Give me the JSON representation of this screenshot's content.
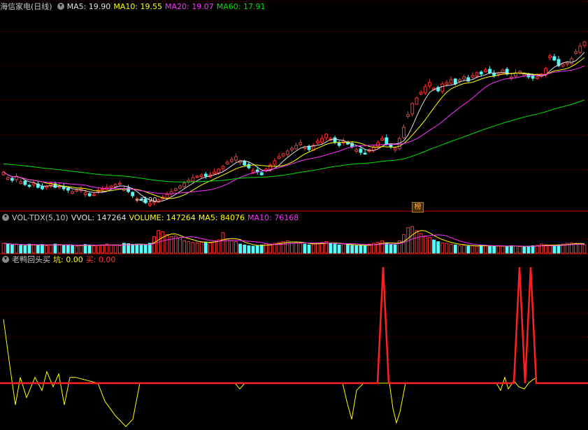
{
  "colors": {
    "up": "#ff3232",
    "down": "#54fcfc",
    "ma5": "#e0e0e0",
    "ma10": "#ffff00",
    "ma20": "#ff30ff",
    "ma60": "#00e000",
    "grid": "#7a0000",
    "sep": "#8a0000"
  },
  "price_panel": {
    "title": "海信家电",
    "period": "(日线)",
    "ma5_label": "MA5: 19.90",
    "ma10_label": "MA10: 19.55",
    "ma20_label": "MA20: 19.07",
    "ma60_label": "MA60: 17.91",
    "low_marker": "←9.90",
    "badge": "榜"
  },
  "volume_panel": {
    "title": "VOL-TDX(5,10)",
    "vvol_label": "VVOL: 147264",
    "volume_label": "VOLUME: 147264",
    "ma5_label": "MA5: 84076",
    "ma10_label": "MA10: 76168"
  },
  "indicator_panel": {
    "title": "老鸭回头买",
    "keng_label": "坑: 0.00",
    "mai_label": "买: 0.00"
  },
  "chart_data": [
    {
      "type": "candlestick",
      "name": "price",
      "close": [
        12.2,
        11.8,
        11.6,
        11.9,
        11.5,
        11.3,
        11.2,
        11.4,
        11.1,
        11.0,
        11.2,
        11.4,
        11.1,
        11.2,
        11.0,
        10.9,
        10.8,
        10.9,
        11.0,
        10.7,
        10.5,
        10.6,
        10.9,
        11.0,
        11.1,
        11.2,
        11.3,
        11.4,
        11.0,
        10.8,
        10.5,
        10.3,
        10.2,
        10.0,
        9.95,
        10.1,
        10.2,
        10.4,
        10.6,
        10.8,
        11.0,
        11.2,
        11.4,
        11.6,
        11.8,
        11.9,
        12.0,
        11.9,
        12.0,
        12.2,
        12.4,
        12.6,
        12.9,
        13.1,
        13.3,
        13.0,
        12.7,
        12.5,
        12.3,
        12.2,
        12.0,
        12.4,
        12.7,
        13.0,
        13.3,
        13.5,
        13.7,
        13.9,
        14.1,
        14.3,
        14.0,
        13.8,
        14.1,
        14.4,
        14.6,
        14.9,
        14.6,
        14.3,
        14.1,
        14.4,
        14.2,
        14.0,
        13.8,
        13.6,
        13.5,
        13.8,
        14.0,
        14.3,
        14.6,
        14.2,
        14.0,
        13.9,
        14.6,
        15.4,
        16.3,
        17.1,
        17.5,
        17.9,
        18.3,
        18.6,
        18.2,
        18.0,
        18.5,
        18.6,
        18.8,
        18.5,
        18.8,
        19.0,
        18.7,
        19.1,
        19.3,
        19.2,
        19.5,
        19.3,
        19.1,
        19.3,
        19.5,
        19.2,
        19.0,
        19.3,
        19.4,
        19.2,
        19.0,
        18.9,
        19.0,
        19.2,
        19.6,
        20.5,
        20.2,
        19.8,
        19.9,
        20.0,
        20.3,
        20.8,
        21.2,
        21.5
      ],
      "ylim": [
        9.5,
        23.5
      ]
    },
    {
      "type": "bar",
      "name": "volume",
      "series": [
        {
          "name": "VVOL",
          "values": [
            24,
            22,
            20,
            21,
            19,
            18,
            22,
            20,
            19,
            21,
            18,
            20,
            22,
            21,
            19,
            20,
            18,
            17,
            19,
            21,
            20,
            18,
            19,
            20,
            22,
            20,
            19,
            18,
            24,
            23,
            21,
            22,
            20,
            21,
            24,
            40,
            55,
            52,
            45,
            40,
            42,
            38,
            30,
            28,
            26,
            25,
            28,
            27,
            25,
            30,
            32,
            50,
            35,
            30,
            28,
            22,
            20,
            18,
            17,
            18,
            20,
            23,
            22,
            24,
            26,
            28,
            30,
            27,
            25,
            24,
            22,
            20,
            22,
            25,
            26,
            28,
            24,
            22,
            20,
            22,
            21,
            19,
            18,
            19,
            18,
            22,
            24,
            26,
            30,
            24,
            21,
            20,
            30,
            45,
            62,
            65,
            55,
            48,
            42,
            38,
            32,
            28,
            25,
            24,
            22,
            20,
            18,
            19,
            17,
            18,
            17,
            19,
            18,
            16,
            17,
            18,
            17,
            16,
            18,
            17,
            16,
            15,
            17,
            18,
            19,
            22,
            20,
            18,
            19,
            20,
            22,
            24,
            25,
            24,
            22,
            20
          ]
        },
        {
          "name": "VOLUME",
          "values": [
            24,
            22,
            20,
            21,
            19,
            18,
            22,
            20,
            19,
            21,
            18,
            20,
            22,
            21,
            19,
            20,
            18,
            17,
            19,
            21,
            20,
            18,
            19,
            20,
            22,
            20,
            19,
            18,
            24,
            23,
            21,
            22,
            20,
            21,
            24,
            40,
            55,
            52,
            45,
            40,
            42,
            38,
            30,
            28,
            26,
            25,
            28,
            27,
            25,
            30,
            32,
            50,
            35,
            30,
            28,
            22,
            20,
            18,
            17,
            18,
            20,
            23,
            22,
            24,
            26,
            28,
            30,
            27,
            25,
            24,
            22,
            20,
            22,
            25,
            26,
            28,
            24,
            22,
            20,
            22,
            21,
            19,
            18,
            19,
            18,
            22,
            24,
            26,
            30,
            24,
            21,
            20,
            30,
            45,
            62,
            65,
            55,
            48,
            42,
            38,
            32,
            28,
            25,
            24,
            22,
            20,
            18,
            19,
            17,
            18,
            17,
            19,
            18,
            16,
            17,
            18,
            17,
            16,
            18,
            17,
            16,
            15,
            17,
            18,
            19,
            22,
            20,
            18,
            19,
            20,
            22,
            24,
            25,
            24,
            22,
            20
          ]
        }
      ]
    },
    {
      "type": "line",
      "name": "indicator",
      "series": [
        {
          "name": "坑",
          "values": [
            [
              5,
              0.55
            ],
            [
              14,
              0.15
            ],
            [
              22,
              -0.3
            ],
            [
              29,
              0.05
            ],
            [
              38,
              -0.2
            ],
            [
              50,
              0.05
            ],
            [
              60,
              -0.1
            ],
            [
              67,
              0.1
            ],
            [
              76,
              -0.05
            ],
            [
              84,
              0.08
            ],
            [
              92,
              -0.3
            ],
            [
              100,
              0.05
            ],
            [
              108,
              0.05
            ],
            [
              140,
              0
            ],
            [
              150,
              -0.25
            ],
            [
              165,
              -0.45
            ],
            [
              180,
              -0.6
            ],
            [
              190,
              -0.5
            ],
            [
              200,
              0
            ],
            [
              336,
              0
            ],
            [
              343,
              -0.08
            ],
            [
              350,
              0
            ],
            [
              490,
              0
            ],
            [
              496,
              -0.25
            ],
            [
              503,
              -0.5
            ],
            [
              510,
              -0.1
            ],
            [
              520,
              0
            ],
            [
              557,
              0
            ],
            [
              562,
              -0.35
            ],
            [
              567,
              -0.55
            ],
            [
              572,
              -0.4
            ],
            [
              580,
              0
            ],
            [
              710,
              0
            ],
            [
              716,
              -0.1
            ],
            [
              722,
              0.05
            ],
            [
              727,
              -0.08
            ],
            [
              735,
              0.02
            ],
            [
              742,
              -0.05
            ],
            [
              750,
              -0.08
            ],
            [
              756,
              0
            ],
            [
              762,
              0.03
            ],
            [
              768,
              0.05
            ]
          ]
        },
        {
          "name": "买",
          "values": [
            [
              0,
              0
            ],
            [
              540,
              0
            ],
            [
              548,
              1
            ],
            [
              556,
              0
            ],
            [
              735,
              0
            ],
            [
              743,
              1
            ],
            [
              751,
              0
            ],
            [
              759,
              1
            ],
            [
              767,
              0
            ],
            [
              841,
              0
            ]
          ]
        }
      ]
    }
  ]
}
